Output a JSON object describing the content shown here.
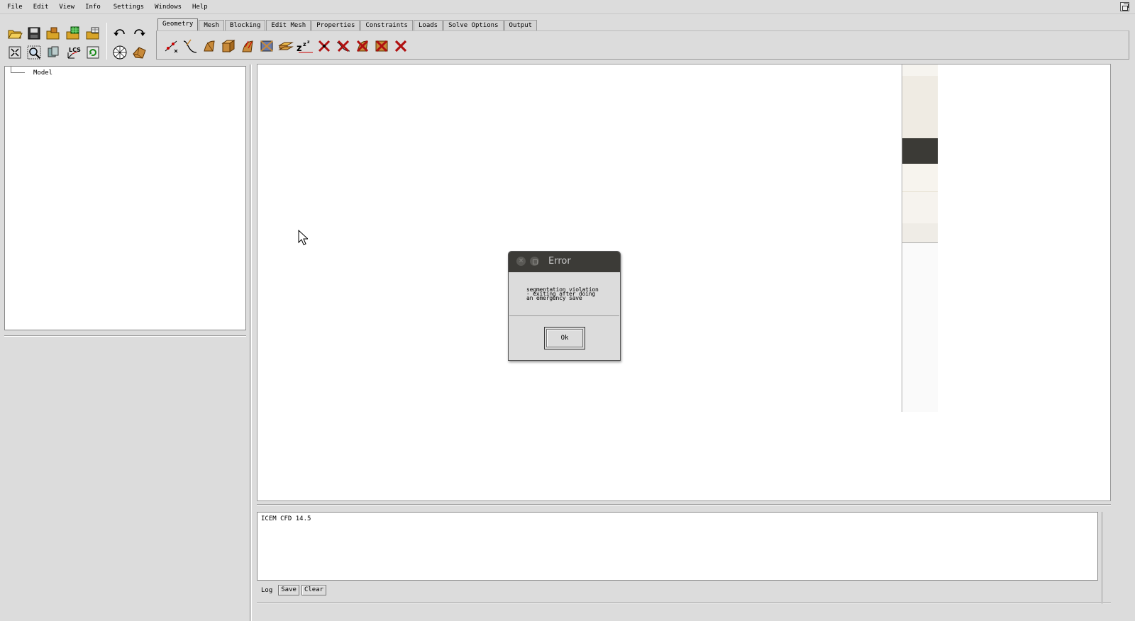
{
  "menu": [
    "File",
    "Edit",
    "View",
    "Info",
    "Settings",
    "Windows",
    "Help"
  ],
  "tabs": [
    "Geometry",
    "Mesh",
    "Blocking",
    "Edit Mesh",
    "Properties",
    "Constraints",
    "Loads",
    "Solve Options",
    "Output"
  ],
  "active_tab": "Geometry",
  "tree": {
    "root_label": "Model"
  },
  "log": {
    "text": "ICEM CFD 14.5",
    "label": "Log",
    "save_label": "Save",
    "clear_label": "Clear"
  },
  "dialog": {
    "title": "Error",
    "message_lines": [
      "segmentation violation",
      "- exiting after doing",
      "an emergency save"
    ],
    "ok_label": "Ok"
  },
  "colors": {
    "dialog_title_bg": "#3c3b37",
    "delete_red": "#b01010",
    "accent_tan": "#c88a3a"
  }
}
